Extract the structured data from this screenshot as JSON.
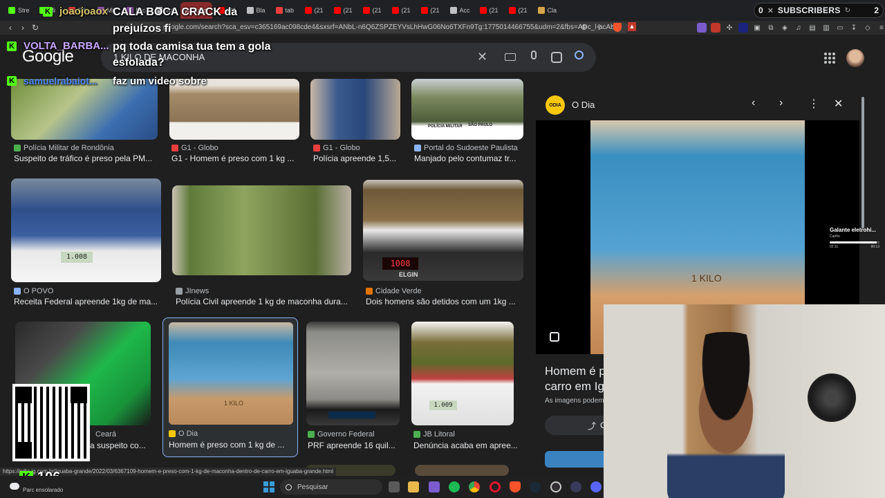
{
  "tabs": [
    {
      "label": "Stre",
      "color": "#53fc18"
    },
    {
      "label": "Mi",
      "color": "#53fc18"
    },
    {
      "label": "G1",
      "color": "#e83e3e"
    },
    {
      "label": "Mic",
      "color": "#9b59b6"
    },
    {
      "label": "Mic",
      "color": "#9b59b6"
    },
    {
      "label": "Vol",
      "color": "#e8eaed"
    },
    {
      "label": "youtube",
      "color": "#8a2a2a"
    },
    {
      "label": "(21",
      "color": "#ff0000"
    },
    {
      "label": "Bla",
      "color": "#bdc1c6"
    },
    {
      "label": "tab",
      "color": "#e83e3e"
    },
    {
      "label": "(21",
      "color": "#ff0000"
    },
    {
      "label": "(21",
      "color": "#ff0000"
    },
    {
      "label": "(21",
      "color": "#ff0000"
    },
    {
      "label": "(21",
      "color": "#ff0000"
    },
    {
      "label": "(21",
      "color": "#ff0000"
    },
    {
      "label": "Acc",
      "color": "#bdc1c6"
    },
    {
      "label": "(21",
      "color": "#ff0000"
    },
    {
      "label": "(21",
      "color": "#ff0000"
    },
    {
      "label": "Cla",
      "color": "#d4a64c"
    }
  ],
  "subscribers": {
    "label": "SUBSCRIBERS",
    "left_count": "0",
    "right_count": "2"
  },
  "url": "google.com/search?sca_esv=c365169ac098cde4&sxsrf=ANbL-n6Q6ZSPZEYVsLhHwG06No6TXFn9Tg:1775014466755&udm=2&fbs=ADc_l-acAb...",
  "google": {
    "logo": "Google",
    "query": "1 KILO DE MACONHA"
  },
  "results": [
    {
      "source": "Polícia Militar de Rondônia",
      "title": "Suspeito de tráfico é preso pela PM...",
      "icon_color": "#4caf50"
    },
    {
      "source": "G1 - Globo",
      "title": "G1 - Homem é preso com 1 kg ...",
      "icon_color": "#e83e3e"
    },
    {
      "source": "G1 - Globo",
      "title": "Polícia apreende 1,5...",
      "icon_color": "#e83e3e"
    },
    {
      "source": "Portal do Sudoeste Paulista",
      "title": "Manjado pelo contumaz tr...",
      "icon_color": "#8ab4f8"
    },
    {
      "source": "O POVO",
      "title": "Receita Federal apreende 1kg de ma...",
      "icon_color": "#8ab4f8"
    },
    {
      "source": "JInews",
      "title": "Polícia Civil apreende 1 kg de maconha dura...",
      "icon_color": "#9aa0a6"
    },
    {
      "source": "Cidade Verde",
      "title": "Dois homens são detidos com um 1kg ...",
      "icon_color": "#e37400"
    },
    {
      "source": "Ceará",
      "title": "a suspeito co...",
      "icon_color": "#8ab4f8"
    },
    {
      "source": "O Dia",
      "title": "Homem é preso com 1 kg de ...",
      "icon_color": "#f9c80e"
    },
    {
      "source": "Governo Federal",
      "title": "PRF apreende 16 quil...",
      "icon_color": "#4caf50"
    },
    {
      "source": "JB Litoral",
      "title": "Denúncia acaba em apree...",
      "icon_color": "#4caf50"
    }
  ],
  "scale_readouts": {
    "r1": "1.008",
    "r2": "1008",
    "r3": "1.009"
  },
  "scale_brand": "ELGIN",
  "image_label": "1 KILO",
  "police_badge": {
    "line1": "POLÍCIA MILITAR",
    "line2": "SÃO PAULO"
  },
  "side_panel": {
    "source": "O Dia",
    "logo_text": "ODIA",
    "title_line1": "Homem é pr",
    "title_line2": "carro em Igu",
    "notice": "As imagens podem",
    "share_label": "C"
  },
  "music_player": {
    "title": "Galante eletrohi...",
    "artist": "Cariño",
    "time_start": "02:11",
    "time_end": "90:13",
    "progress": 0.95
  },
  "chat": [
    {
      "user": "joaojoaox",
      "text": "CALA BOCA CRACK da"
    },
    {
      "user": "",
      "text": "prejuízos fi"
    },
    {
      "user": "VOLTA_BARBA...",
      "text": "pq toda camisa tua tem a gola"
    },
    {
      "user": "",
      "text": "esfolada?"
    },
    {
      "user": "samuelrabaiot...",
      "text": "faz um video sobre"
    }
  ],
  "status_url": "https://odia.ig.com.br/iguaba-grande/2022/03/6367109-homem-e-preso-com-1-kg-de-maconha-dentro-de-carro-em-iguaba-grande.html",
  "follower_count": "106",
  "weather": "Parc ensolarado",
  "taskbar": {
    "search_placeholder": "Pesquisar"
  }
}
